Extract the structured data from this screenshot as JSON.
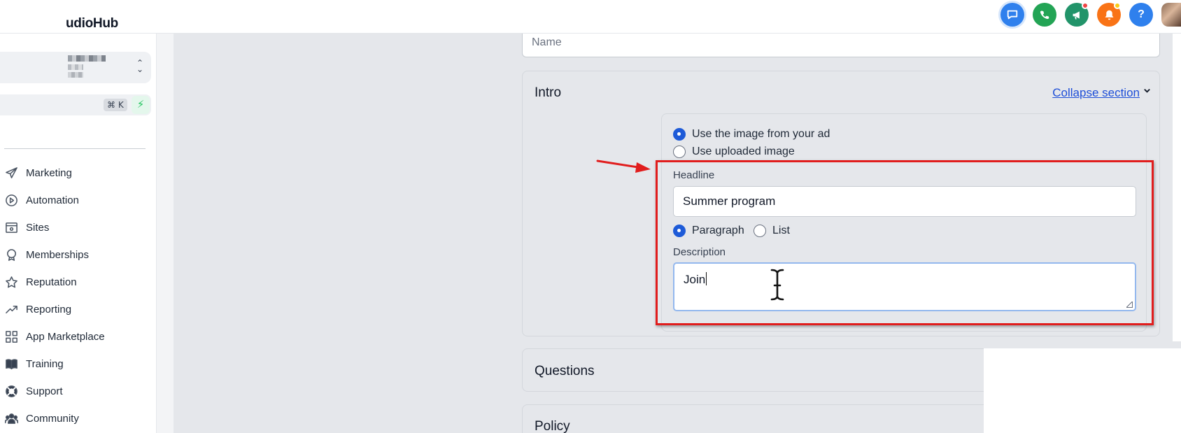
{
  "app": {
    "brand": "udioHub"
  },
  "header": {
    "icons": [
      "chat-icon",
      "phone-icon",
      "megaphone-icon",
      "bell-icon",
      "help-icon"
    ],
    "help_label": "?"
  },
  "sidebar": {
    "search_shortcut": "⌘ K",
    "items": [
      {
        "label": "Marketing",
        "icon": "send-icon"
      },
      {
        "label": "Automation",
        "icon": "play-circle-icon"
      },
      {
        "label": "Sites",
        "icon": "browser-icon"
      },
      {
        "label": "Memberships",
        "icon": "award-icon"
      },
      {
        "label": "Reputation",
        "icon": "star-icon"
      },
      {
        "label": "Reporting",
        "icon": "trend-icon"
      },
      {
        "label": "App Marketplace",
        "icon": "grid-icon"
      },
      {
        "label": "Training",
        "icon": "book-icon"
      },
      {
        "label": "Support",
        "icon": "lifebuoy-icon"
      },
      {
        "label": "Community",
        "icon": "users-icon"
      }
    ]
  },
  "form": {
    "name_placeholder": "Name",
    "intro": {
      "title": "Intro",
      "collapse_label": "Collapse section",
      "image_options": [
        {
          "label": "Use the image from your ad",
          "selected": true
        },
        {
          "label": "Use uploaded image",
          "selected": false
        }
      ],
      "headline_label": "Headline",
      "headline_value": "Summer program",
      "format_options": [
        {
          "label": "Paragraph",
          "selected": true
        },
        {
          "label": "List",
          "selected": false
        }
      ],
      "description_label": "Description",
      "description_value": "Join"
    },
    "sections": [
      {
        "title": "Questions"
      },
      {
        "title": "Policy"
      }
    ]
  },
  "colors": {
    "accent": "#1e5bd8",
    "highlight": "#e11d1d",
    "link": "#1d4ed8"
  }
}
